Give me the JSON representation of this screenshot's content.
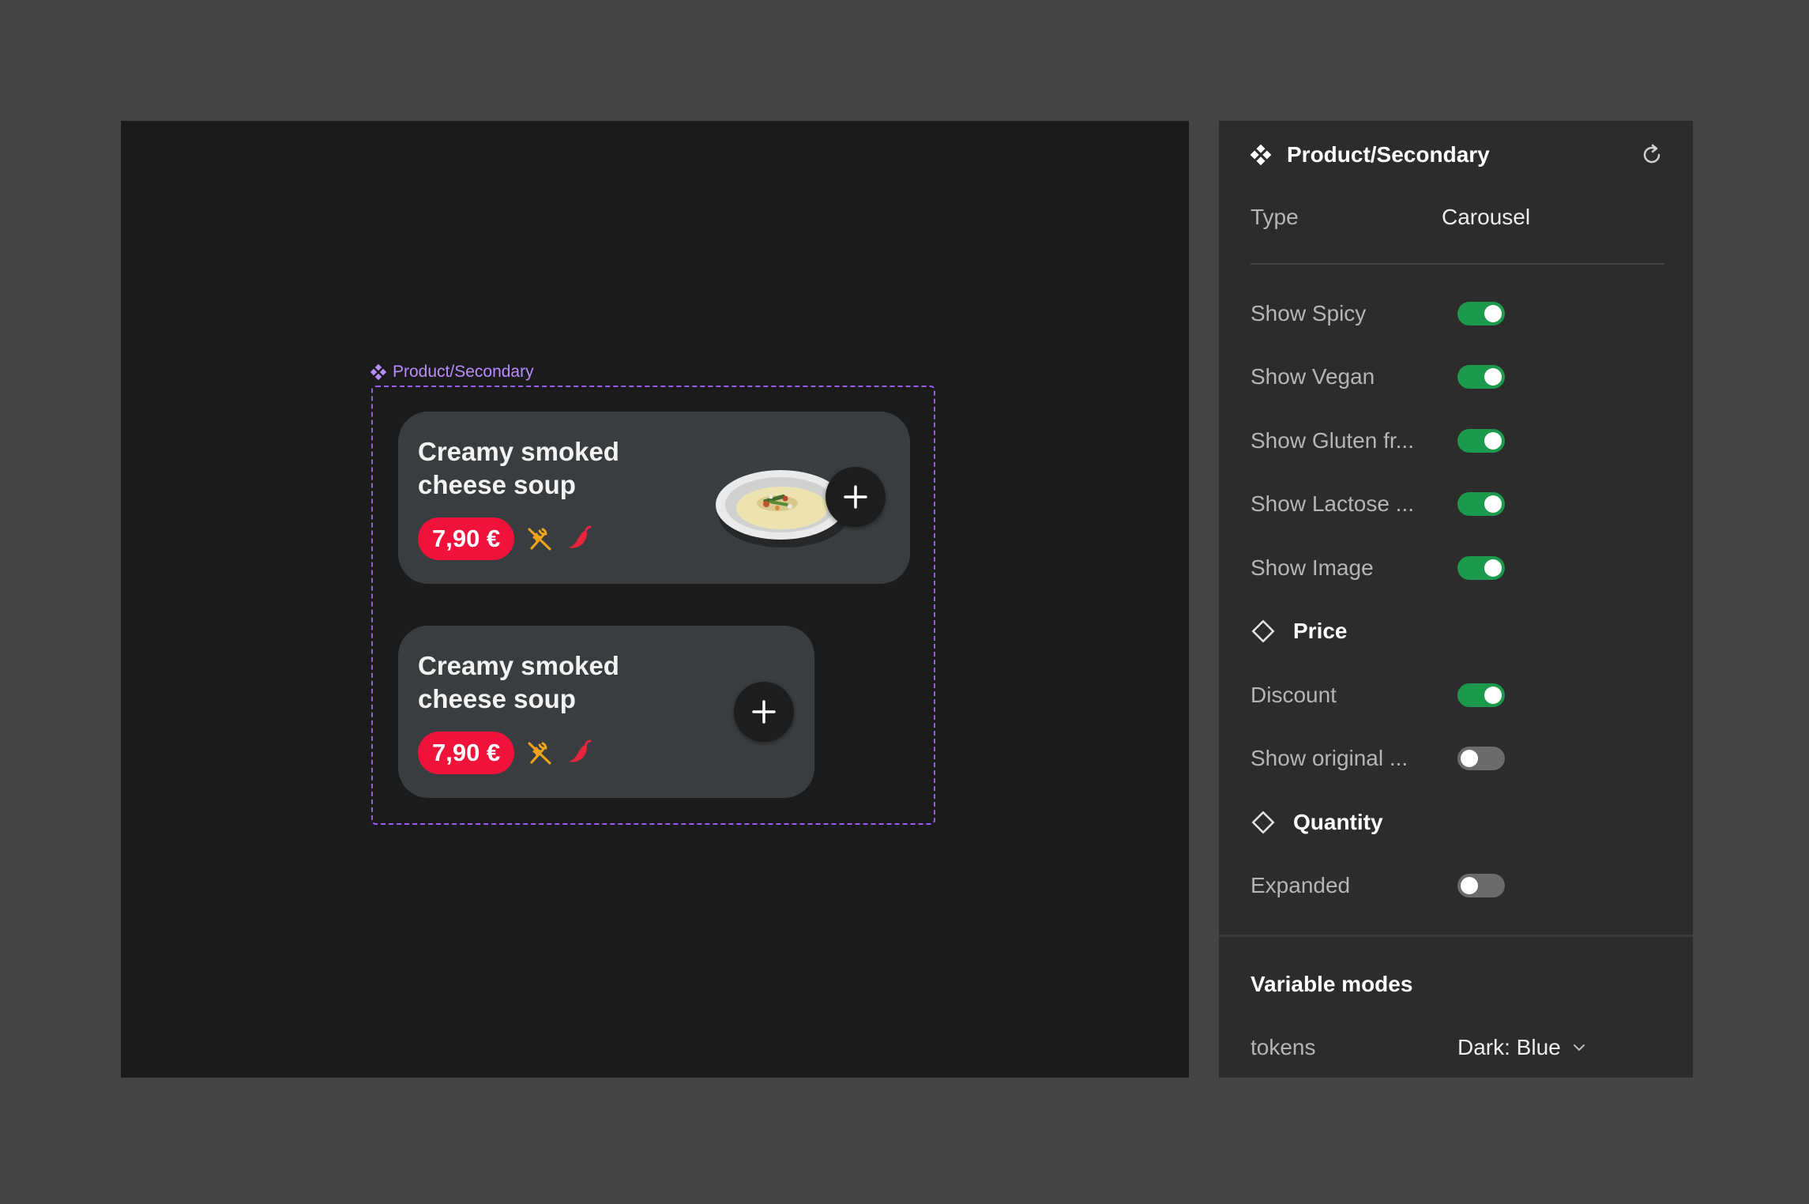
{
  "frame": {
    "label": "Product/Secondary"
  },
  "cards": [
    {
      "title": "Creamy smoked\ncheese soup",
      "price": "7,90 €",
      "show_image": true
    },
    {
      "title": "Creamy smoked\ncheese soup",
      "price": "7,90 €",
      "show_image": false
    }
  ],
  "panel": {
    "title": "Product/Secondary",
    "type_label": "Type",
    "type_value": "Carousel",
    "toggles": [
      {
        "label": "Show Spicy",
        "on": true
      },
      {
        "label": "Show Vegan",
        "on": true
      },
      {
        "label": "Show Gluten fr...",
        "on": true
      },
      {
        "label": "Show Lactose ...",
        "on": true
      },
      {
        "label": "Show Image",
        "on": true
      }
    ],
    "price_section": {
      "title": "Price",
      "toggles": [
        {
          "label": "Discount",
          "on": true
        },
        {
          "label": "Show original ...",
          "on": false
        }
      ]
    },
    "quantity_section": {
      "title": "Quantity",
      "toggles": [
        {
          "label": "Expanded",
          "on": false
        }
      ]
    },
    "variable_modes": {
      "title": "Variable modes",
      "label": "tokens",
      "value": "Dark: Blue"
    }
  },
  "colors": {
    "background": "#444444",
    "canvas": "#1b1b1b",
    "card": "#3a3d3f",
    "price_badge": "#f0123a",
    "frame_outline": "#9b59f5",
    "toggle_on": "#1b9a4b",
    "toggle_off": "#6b6b6b"
  },
  "icons": [
    "component-icon",
    "reset-icon",
    "gluten-free-icon",
    "chili-icon",
    "plus-icon",
    "diamond-icon",
    "chevron-down-icon"
  ]
}
